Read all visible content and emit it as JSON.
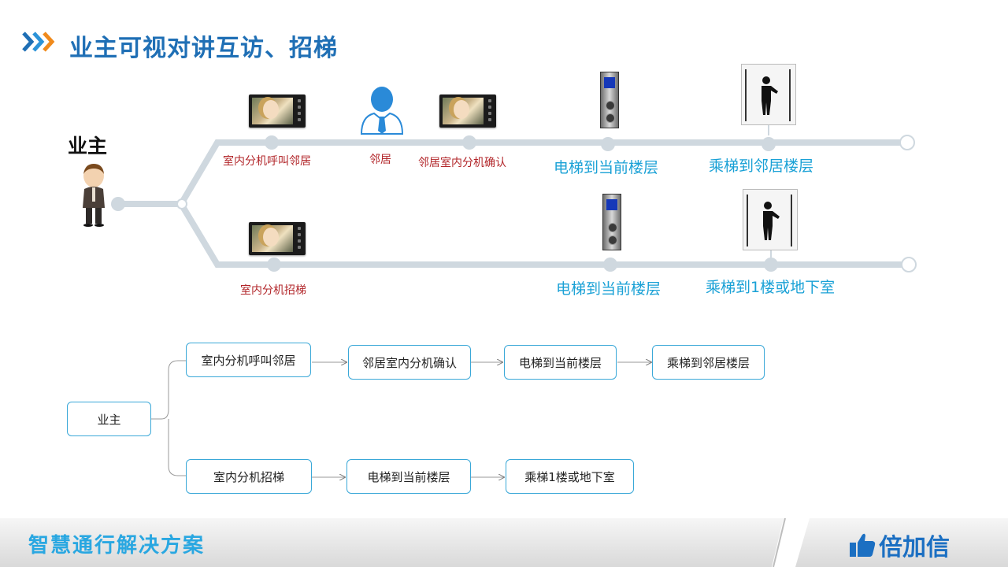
{
  "header": {
    "title": "业主可视对讲互访、招梯"
  },
  "owner": {
    "label": "业主"
  },
  "route_top": {
    "steps": [
      {
        "label": "室内分机呼叫邻居"
      },
      {
        "label": "邻居"
      },
      {
        "label": "邻居室内分机确认"
      },
      {
        "label": "电梯到当前楼层"
      },
      {
        "label": "乘梯到邻居楼层"
      }
    ]
  },
  "route_bottom": {
    "steps": [
      {
        "label": "室内分机招梯"
      },
      {
        "label": "电梯到当前楼层"
      },
      {
        "label": "乘梯到1楼或地下室"
      }
    ]
  },
  "flowchart": {
    "root": "业主",
    "branch_a": [
      "室内分机呼叫邻居",
      "邻居室内分机确认",
      "电梯到当前楼层",
      "乘梯到邻居楼层"
    ],
    "branch_b": [
      "室内分机招梯",
      "电梯到当前楼层",
      "乘梯1楼或地下室"
    ]
  },
  "footer": {
    "title": "智慧通行解决方案",
    "brand": "倍加信"
  },
  "colors": {
    "title_blue": "#1f6fb5",
    "line_gray": "#cfd8df",
    "red_label": "#b2262a",
    "blue_label": "#1aa1d6",
    "box_border": "#3aa8d8",
    "brand_blue": "#1b6fc2"
  },
  "icons": [
    "chevron-arrows-icon",
    "owner-person-icon",
    "neighbor-person-icon",
    "indoor-monitor-icon",
    "elevator-panel-icon",
    "elevator-cabin-icon",
    "thumbs-up-icon"
  ]
}
